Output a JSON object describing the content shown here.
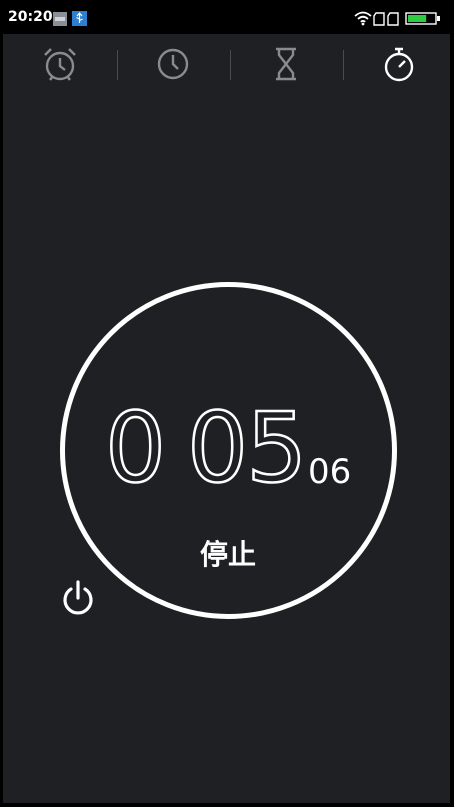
{
  "status_bar": {
    "time": "20:20",
    "notification_icons": [
      "image-notification-icon",
      "usb-debug-icon"
    ],
    "right_icons": [
      "wifi-icon",
      "sim-1-icon",
      "sim-2-icon",
      "battery-icon"
    ],
    "battery_level": 0.7,
    "battery_color": "#2ecc40"
  },
  "tabs": [
    {
      "name": "alarm",
      "icon": "alarm-clock-icon",
      "active": false
    },
    {
      "name": "world-clock",
      "icon": "clock-icon",
      "active": false
    },
    {
      "name": "timer",
      "icon": "hourglass-icon",
      "active": false
    },
    {
      "name": "stopwatch",
      "icon": "stopwatch-icon",
      "active": true
    }
  ],
  "stopwatch": {
    "minutes": "0",
    "seconds": "05",
    "hundredths": "06",
    "stop_label": "停止",
    "reset_icon": "reset-icon"
  },
  "colors": {
    "background": "#1f2023",
    "foreground": "#ffffff",
    "inactive_icon": "#8a8b8f"
  }
}
